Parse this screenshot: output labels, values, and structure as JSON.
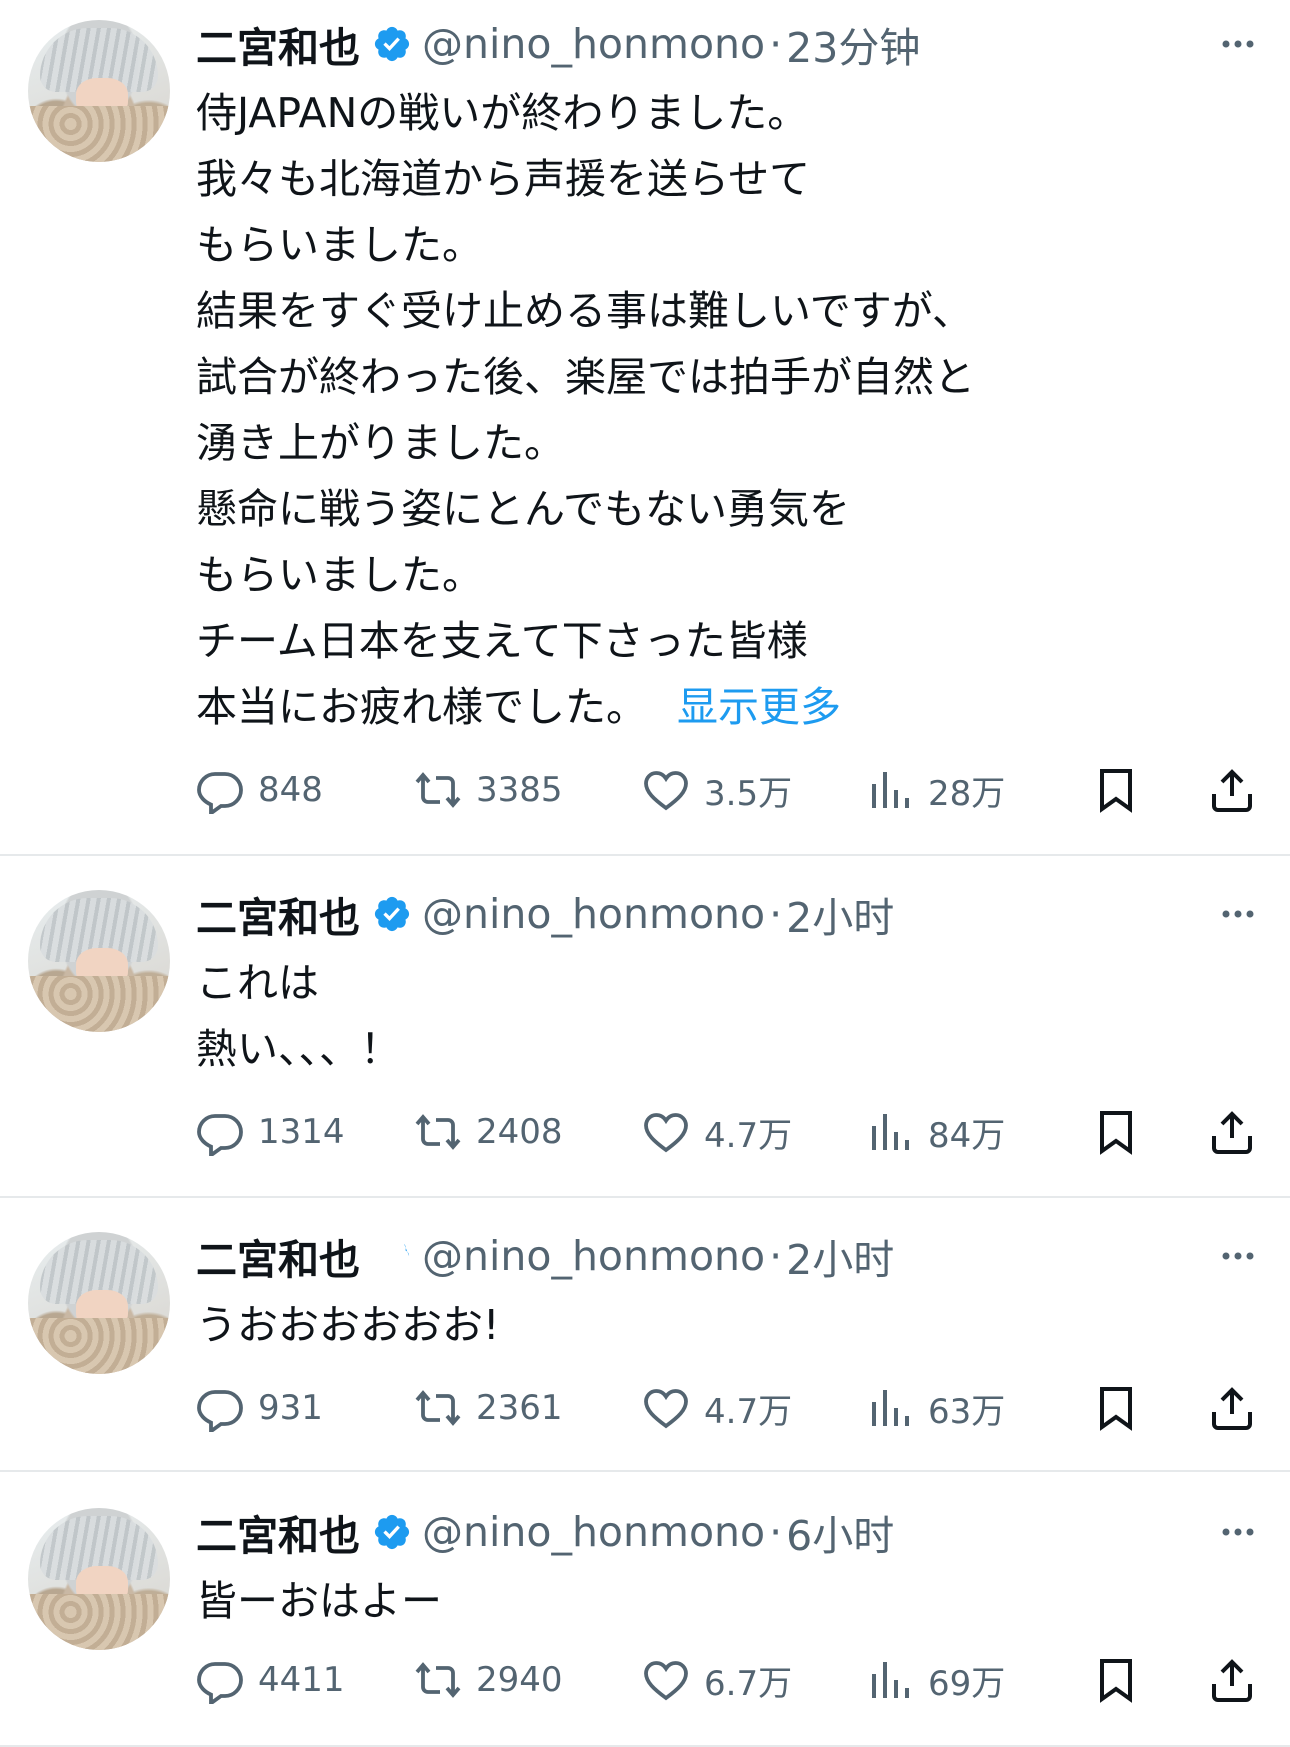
{
  "tweets": [
    {
      "author": {
        "name": "二宮和也",
        "handle": "@nino_honmono"
      },
      "time": "23分钟",
      "text": "侍JAPANの戦いが終わりました。\n我々も北海道から声援を送らせて\nもらいました。\n結果をすぐ受け止める事は難しいですが、\n試合が終わった後、楽屋では拍手が自然と\n湧き上がりました。\n懸命に戦う姿にとんでもない勇気を\nもらいました。\nチーム日本を支えて下さった皆様\n本当にお疲れ様でした。",
      "show_more": "显示更多",
      "stats": {
        "replies": "848",
        "retweets": "3385",
        "likes": "3.5万",
        "views": "28万"
      }
    },
    {
      "author": {
        "name": "二宮和也",
        "handle": "@nino_honmono"
      },
      "time": "2小时",
      "text": "これは\n熱い、、、！",
      "stats": {
        "replies": "1314",
        "retweets": "2408",
        "likes": "4.7万",
        "views": "84万"
      }
    },
    {
      "author": {
        "name": "二宮和也",
        "handle": "@nino_honmono"
      },
      "time": "2小时",
      "text": "うおおおおおお!",
      "stats": {
        "replies": "931",
        "retweets": "2361",
        "likes": "4.7万",
        "views": "63万"
      }
    },
    {
      "author": {
        "name": "二宮和也",
        "handle": "@nino_honmono"
      },
      "time": "6小时",
      "text": "皆ーおはよー",
      "stats": {
        "replies": "4411",
        "retweets": "2940",
        "likes": "6.7万",
        "views": "69万"
      }
    }
  ],
  "icons": {
    "verified": "verified-badge-icon",
    "more": "more-dots-icon",
    "reply": "reply-icon",
    "retweet": "retweet-icon",
    "like": "heart-icon",
    "views": "views-icon",
    "bookmark": "bookmark-icon",
    "share": "share-icon"
  },
  "colors": {
    "verified": "#1d9bf0",
    "link": "#1d9bf0",
    "muted": "#536471",
    "text": "#0f1419"
  }
}
